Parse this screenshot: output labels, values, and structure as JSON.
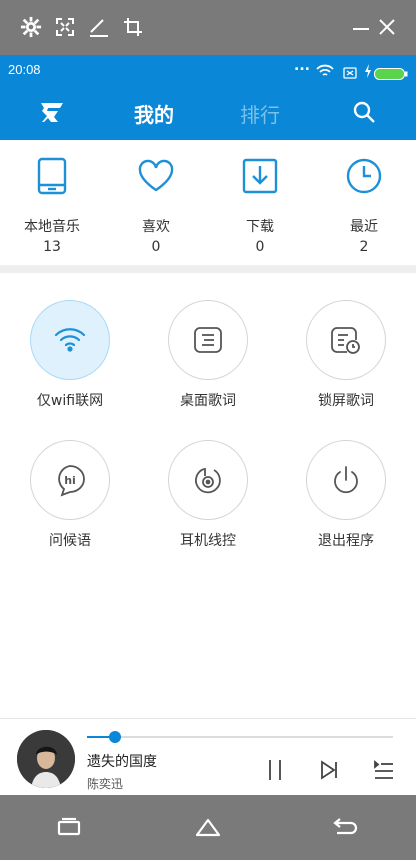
{
  "status": {
    "time": "20:08",
    "dots": "..."
  },
  "header": {
    "tabs": [
      {
        "label": "我的"
      },
      {
        "label": "排行"
      }
    ]
  },
  "stats": [
    {
      "label": "本地音乐",
      "count": "13"
    },
    {
      "label": "喜欢",
      "count": "0"
    },
    {
      "label": "下载",
      "count": "0"
    },
    {
      "label": "最近",
      "count": "2"
    }
  ],
  "functions": [
    {
      "label": "仅wifi联网"
    },
    {
      "label": "桌面歌词"
    },
    {
      "label": "锁屏歌词"
    },
    {
      "label": "问候语"
    },
    {
      "label": "耳机线控"
    },
    {
      "label": "退出程序"
    }
  ],
  "greeting_icon_text": "hi",
  "player": {
    "song": "遗失的国度",
    "artist": "陈奕迅",
    "progress": 0.09
  },
  "colors": {
    "accent": "#0a87d6",
    "emulator": "#7a7a7a",
    "icon_blue": "#1e90d8"
  }
}
